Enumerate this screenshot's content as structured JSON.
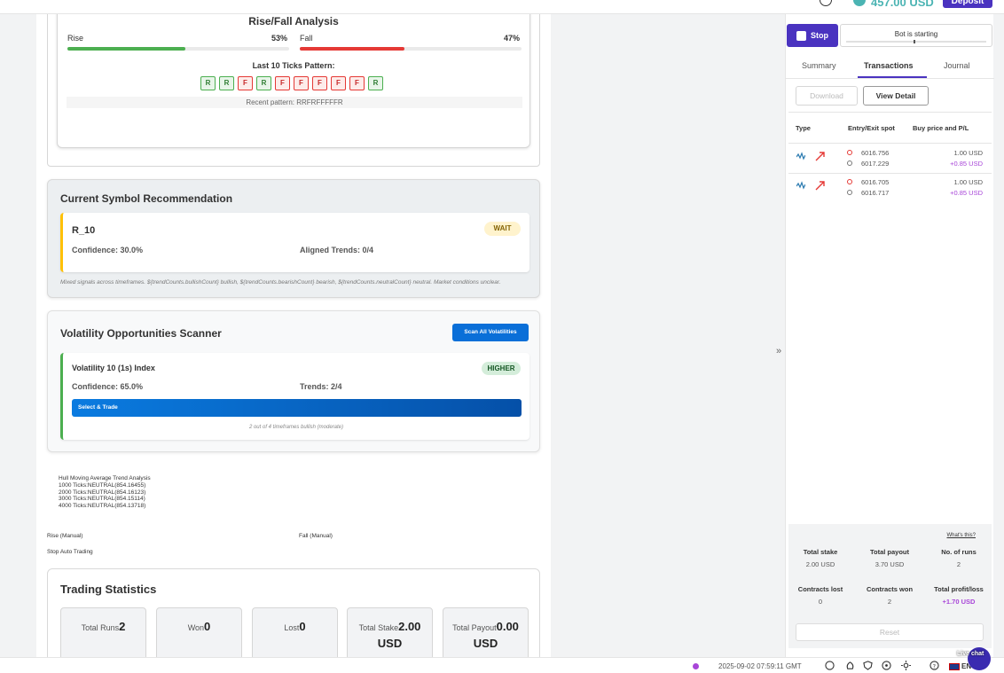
{
  "topbar": {
    "balance": "457.00 USD",
    "deposit_label": "Deposit"
  },
  "rise_fall": {
    "title": "Rise/Fall Analysis",
    "rise_label": "Rise",
    "rise_pct": "53%",
    "rise_fraction": 0.53,
    "fall_label": "Fall",
    "fall_pct": "47%",
    "fall_fraction": 0.47,
    "pattern_title": "Last 10 Ticks Pattern:",
    "ticks": [
      "R",
      "R",
      "F",
      "R",
      "F",
      "F",
      "F",
      "F",
      "F",
      "R"
    ],
    "recent_pattern": "Recent pattern: RRFRFFFFFR",
    "colors": {
      "rise": "#4caf50",
      "fall": "#e53935"
    }
  },
  "recommendation": {
    "title": "Current Symbol Recommendation",
    "symbol": "R_10",
    "badge": "WAIT",
    "confidence": "Confidence: 30.0%",
    "aligned": "Aligned Trends: 0/4",
    "note": "Mixed signals across timeframes. ${trendCounts.bullishCount} bullish, ${trendCounts.bearishCount} bearish, ${trendCounts.neutralCount} neutral. Market conditions unclear."
  },
  "scanner": {
    "title": "Volatility Opportunities Scanner",
    "scan_button": "Scan All Volatilities",
    "name": "Volatility 10 (1s) Index",
    "badge": "HIGHER",
    "confidence": "Confidence: 65.0%",
    "trends": "Trends: 2/4",
    "select_button": "Select & Trade",
    "note": "2 out of 4 timeframes bullish (moderate)"
  },
  "hma": {
    "title": "Hull Moving Average Trend Analysis",
    "lines": [
      "1000 Ticks:NEUTRAL(854.16455)",
      "2000 Ticks:NEUTRAL(854.16123)",
      "3000 Ticks:NEUTRAL(854.15114)",
      "4000 Ticks:NEUTRAL(854.13718)"
    ]
  },
  "manual": {
    "rise": "Rise (Manual)",
    "fall": "Fall (Manual)",
    "stop_auto": "Stop Auto Trading"
  },
  "stats": {
    "title": "Trading Statistics",
    "boxes": [
      {
        "label": "Total Runs",
        "value": "2"
      },
      {
        "label": "Won",
        "value": "0"
      },
      {
        "label": "Lost",
        "value": "0"
      },
      {
        "label": "Total Stake",
        "value": "2.00 USD"
      },
      {
        "label": "Total Payout",
        "value": "0.00 USD"
      }
    ]
  },
  "bot": {
    "stop_label": "Stop",
    "status": "Bot is starting"
  },
  "tabs": [
    "Summary",
    "Transactions",
    "Journal"
  ],
  "active_tab": "Transactions",
  "buttons": {
    "download": "Download",
    "view_detail": "View Detail"
  },
  "table": {
    "headers": [
      "Type",
      "Entry/Exit spot",
      "Buy price and P/L"
    ],
    "rows": [
      {
        "entry": "6016.756",
        "exit": "6017.229",
        "price": "1.00 USD",
        "pnl": "+0.85 USD"
      },
      {
        "entry": "6016.705",
        "exit": "6016.717",
        "price": "1.00 USD",
        "pnl": "+0.85 USD"
      }
    ]
  },
  "summary": {
    "whats_this": "What's this?",
    "total_stake_label": "Total stake",
    "total_stake": "2.00 USD",
    "total_payout_label": "Total payout",
    "total_payout": "3.70 USD",
    "runs_label": "No. of runs",
    "runs": "2",
    "lost_label": "Contracts lost",
    "lost": "0",
    "won_label": "Contracts won",
    "won": "2",
    "pl_label": "Total profit/loss",
    "pl": "+1.70 USD",
    "reset_label": "Reset"
  },
  "footer": {
    "time": "2025-09-02 07:59:11 GMT",
    "lang": "EN",
    "chat_text": "Live chat"
  }
}
